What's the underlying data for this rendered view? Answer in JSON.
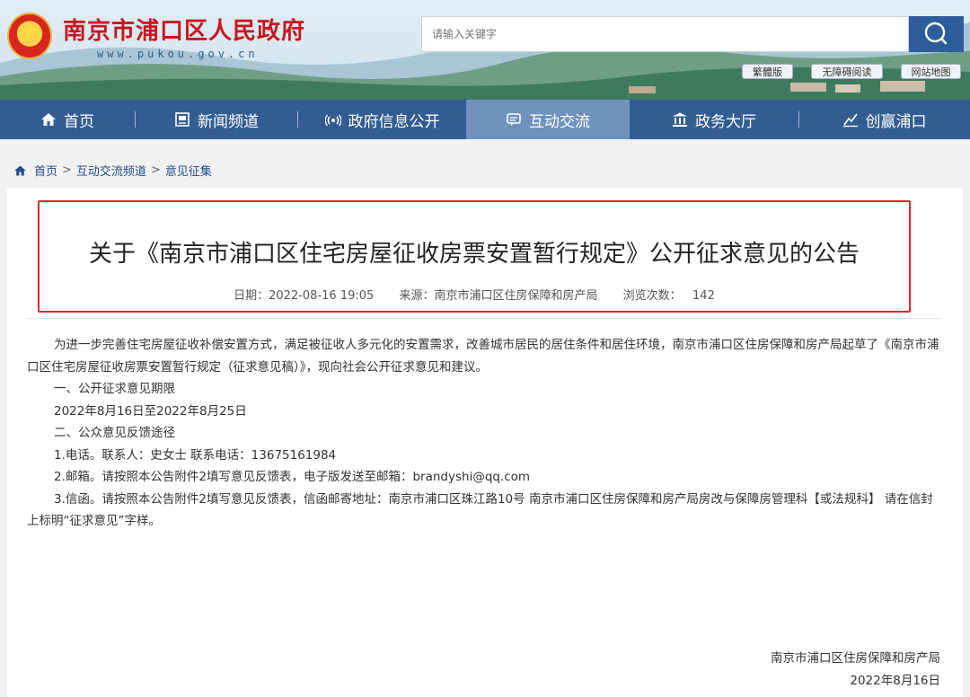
{
  "header": {
    "site_title": "南京市浦口区人民政府",
    "site_domain": "www.pukou.gov.cn",
    "search_placeholder": "请输入关键字",
    "top_links": [
      "繁體版",
      "无障碍阅读",
      "网站地图"
    ]
  },
  "nav": {
    "items": [
      {
        "label": "首页",
        "icon": "home-icon"
      },
      {
        "label": "新闻频道",
        "icon": "news-icon"
      },
      {
        "label": "政府信息公开",
        "icon": "broadcast-icon"
      },
      {
        "label": "互动交流",
        "icon": "chat-icon",
        "active": true
      },
      {
        "label": "政务大厅",
        "icon": "government-hall-icon"
      },
      {
        "label": "创赢浦口",
        "icon": "chart-up-icon"
      }
    ]
  },
  "breadcrumb": [
    "首页",
    "互动交流频道",
    "意见征集"
  ],
  "article": {
    "title": "关于《南京市浦口区住宅房屋征收房票安置暂行规定》公开征求意见的公告",
    "date_label": "日期：",
    "date": "2022-08-16 19:05",
    "source_label": "来源：",
    "source": "南京市浦口区住房保障和房产局",
    "views_label": "浏览次数：",
    "views": "142",
    "paragraphs": [
      "为进一步完善住宅房屋征收补偿安置方式，满足被征收人多元化的安置需求，改善城市居民的居住条件和居住环境，南京市浦口区住房保障和房产局起草了《南京市浦口区住宅房屋征收房票安置暂行规定（征求意见稿）》，现向社会公开征求意见和建议。",
      "一、公开征求意见期限",
      "2022年8月16日至2022年8月25日",
      "二、公众意见反馈途径",
      "1.电话。联系人：史女士 联系电话：13675161984",
      "2.邮箱。请按照本公告附件2填写意见反馈表，电子版发送至邮箱：brandyshi@qq.com",
      "3.信函。请按照本公告附件2填写意见反馈表，信函邮寄地址：南京市浦口区珠江路10号 南京市浦口区住房保障和房产局房改与保障房管理科【或法规科】 请在信封上标明“征求意见”字样。"
    ],
    "signature_org": "南京市浦口区住房保障和房产局",
    "signature_date": "2022年8月16日"
  },
  "colors": {
    "nav_bg": "#335d92",
    "nav_active": "#6f93bd",
    "title_red": "#c8161d",
    "highlight_border": "#e5252a",
    "link_blue": "#1f4e8c"
  }
}
